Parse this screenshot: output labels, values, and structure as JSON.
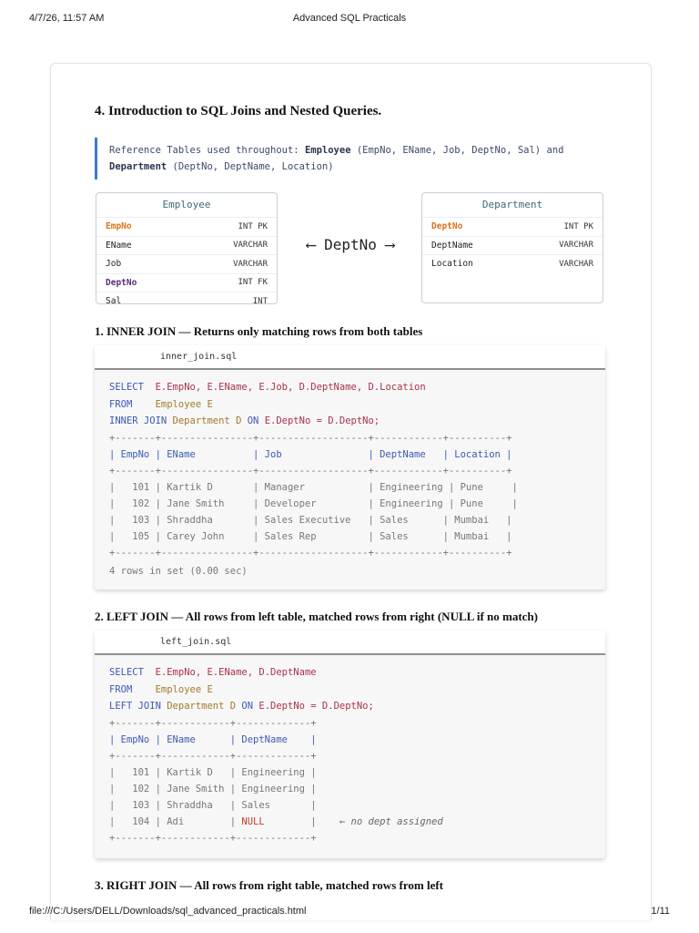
{
  "print": {
    "datetime": "4/7/26, 11:57 AM",
    "doc_title": "Advanced SQL Practicals",
    "file_path": "file:///C:/Users/DELL/Downloads/sql_advanced_practicals.html",
    "page_indicator": "1/11"
  },
  "section": {
    "title": "4. Introduction to SQL Joins and Nested Queries."
  },
  "callout": {
    "prefix": "Reference Tables used throughout: ",
    "table1": "Employee",
    "table1_cols": " (EmpNo, EName, Job, DeptNo, Sal) and",
    "table2": "Department",
    "table2_cols": " (DeptNo, DeptName, Location)"
  },
  "schema": {
    "employee": {
      "title": "Employee",
      "rows": [
        {
          "name": "EmpNo",
          "type": "INT PK"
        },
        {
          "name": "EName",
          "type": "VARCHAR"
        },
        {
          "name": "Job",
          "type": "VARCHAR"
        },
        {
          "name": "DeptNo",
          "type": "INT FK"
        },
        {
          "name": "Sal",
          "type": "INT"
        }
      ]
    },
    "department": {
      "title": "Department",
      "rows": [
        {
          "name": "DeptNo",
          "type": "INT PK"
        },
        {
          "name": "DeptName",
          "type": "VARCHAR"
        },
        {
          "name": "Location",
          "type": "VARCHAR"
        }
      ]
    },
    "relation": "⟵ DeptNo ⟶",
    "colors": {
      "pk": "#d9731a",
      "fk": "#5a2b7a"
    }
  },
  "inner_join": {
    "heading": "1. INNER JOIN — Returns only matching rows from both tables",
    "filename": "inner_join.sql",
    "query": {
      "l1_kw": "SELECT",
      "l1_rest": "  E.EmpNo, E.EName, E.Job, D.DeptName, D.Location",
      "l2_kw": "FROM",
      "l2_rest": "    Employee E",
      "l3_kw": "INNER JOIN",
      "l3_tbl": " Department D",
      "l3_on": " ON",
      "l3_rest": " E.DeptNo = D.DeptNo;"
    },
    "result_lines": [
      "+-------+----------------+-------------------+------------+----------+",
      "| EmpNo | EName          | Job               | DeptName   | Location |",
      "+-------+----------------+-------------------+------------+----------+",
      "|   101 | Kartik D       | Manager           | Engineering | Pune     |",
      "|   102 | Jane Smith     | Developer         | Engineering | Pune     |",
      "|   103 | Shraddha       | Sales Executive   | Sales      | Mumbai   |",
      "|   105 | Carey John     | Sales Rep         | Sales      | Mumbai   |",
      "+-------+----------------+-------------------+------------+----------+"
    ],
    "summary": "4 rows in set (0.00 sec)"
  },
  "left_join": {
    "heading": "2. LEFT JOIN — All rows from left table, matched rows from right (NULL if no match)",
    "filename": "left_join.sql",
    "query": {
      "l1_kw": "SELECT",
      "l1_rest": "  E.EmpNo, E.EName, D.DeptName",
      "l2_kw": "FROM",
      "l2_rest": "    Employee E",
      "l3_kw": "LEFT JOIN",
      "l3_tbl": " Department D",
      "l3_on": " ON",
      "l3_rest": " E.DeptNo = D.DeptNo;"
    },
    "result_lines": [
      "+-------+------------+-------------+",
      "| EmpNo | EName      | DeptName    |",
      "+-------+------------+-------------+",
      "|   101 | Kartik D   | Engineering |",
      "|   102 | Jane Smith | Engineering |",
      "|   103 | Shraddha   | Sales       |"
    ],
    "null_row": {
      "prefix": "|   104 | Adi        | ",
      "null": "NULL",
      "suffix": "        |",
      "note": "    ← no dept assigned"
    },
    "result_end": "+-------+------------+-------------+"
  },
  "right_join": {
    "heading": "3. RIGHT JOIN — All rows from right table, matched rows from left"
  }
}
